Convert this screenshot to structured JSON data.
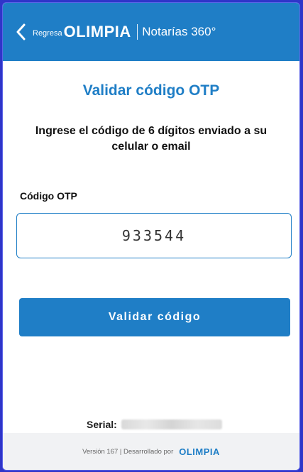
{
  "header": {
    "back_label": "Regresa",
    "logo_text": "OLIMPIA",
    "subtitle": "Notarías 360°",
    "back_icon": "chevron-left-icon"
  },
  "main": {
    "title": "Validar código OTP",
    "instructions": "Ingrese el código de 6 dígitos enviado a su celular o email",
    "otp_label": "Código OTP",
    "otp_value": "933544",
    "validate_button": "Validar código",
    "serial_label": "Serial:"
  },
  "footer": {
    "version_text": "Versión 167 | Desarrollado por",
    "logo_text": "OLIMPIA"
  },
  "colors": {
    "primary": "#1f7ec6",
    "frame_border": "#2f35c9",
    "footer_bg": "#f1f2f4"
  }
}
